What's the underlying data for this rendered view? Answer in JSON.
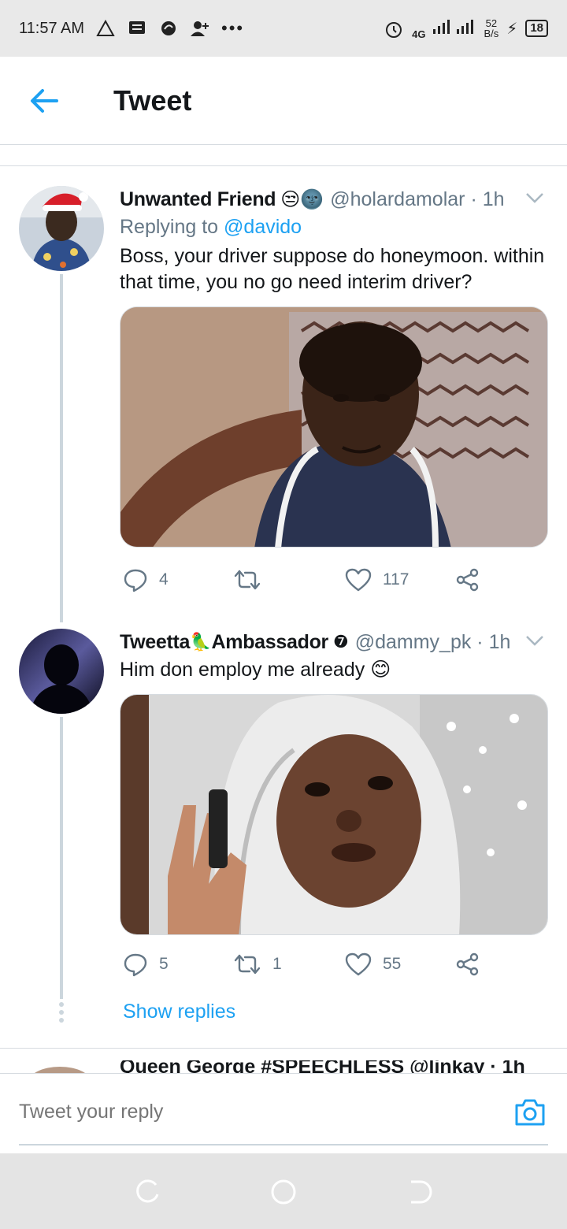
{
  "status_bar": {
    "time": "11:57 AM",
    "network": "4G",
    "speed_value": "52",
    "speed_unit": "B/s",
    "battery": "18"
  },
  "header": {
    "title": "Tweet"
  },
  "tweets": [
    {
      "name": "Unwanted Friend",
      "name_emojis": "😒🌚",
      "handle": "@holardamolar · 1h",
      "replying_prefix": "Replying to",
      "replying_to": "@davido",
      "text": "Boss, your driver suppose do honeymoon. within that time, you no go need interim driver?",
      "replies": "4",
      "retweets": "",
      "likes": "117"
    },
    {
      "name_part1": "Tweetta",
      "name_emoji": "🦜",
      "name_part2": "Ambassador",
      "badge": "❼",
      "handle": "@dammy_pk · 1h",
      "text": "Him don employ me already",
      "text_emoji": "😊",
      "replies": "5",
      "retweets": "1",
      "likes": "55"
    }
  ],
  "show_replies": "Show replies",
  "peek_tweet": {
    "name": "Queen George #SPEECHLESS @linkay · 1h"
  },
  "composer": {
    "placeholder": "Tweet your reply"
  },
  "colors": {
    "accent": "#1da1f2",
    "secondary_text": "#657786",
    "divider": "#d6dbe0"
  }
}
